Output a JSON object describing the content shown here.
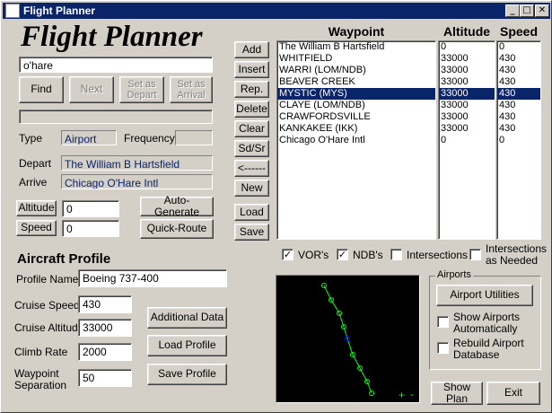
{
  "window": {
    "title": "Flight Planner"
  },
  "logo_text": "Flight Planner",
  "search": {
    "value": "o'hare"
  },
  "buttons": {
    "find": "Find",
    "next": "Next",
    "set_depart": "Set as Depart",
    "set_arrival": "Set as Arrival",
    "altitude": "Altitude",
    "speed": "Speed",
    "auto_generate": "Auto-Generate",
    "quick_route": "Quick-Route",
    "additional_data": "Additional Data",
    "load_profile": "Load Profile",
    "save_profile": "Save Profile",
    "airport_utilities": "Airport Utilities",
    "show_plan": "Show Plan",
    "exit": "Exit"
  },
  "info": {
    "type_label": "Type",
    "type_value": "Airport",
    "frequency_label": "Frequency",
    "frequency_value": "",
    "depart_label": "Depart",
    "depart_value": "The William B Hartsfield",
    "arrive_label": "Arrive",
    "arrive_value": "Chicago O'Hare Intl"
  },
  "route_inputs": {
    "altitude": "0",
    "speed": "0"
  },
  "aircraft_profile": {
    "title": "Aircraft Profile",
    "profile_name_label": "Profile Name",
    "profile_name": "Boeing 737-400",
    "cruise_speed_label": "Cruise Speed",
    "cruise_speed": "430",
    "cruise_altitude_label": "Cruise Altitude",
    "cruise_altitude": "33000",
    "climb_rate_label": "Climb Rate",
    "climb_rate": "2000",
    "waypoint_separation_label": "Waypoint Separation",
    "waypoint_separation": "50"
  },
  "list_buttons": [
    "Add",
    "Insert",
    "Rep.",
    "Delete",
    "Clear",
    "Sd/Sr",
    "<------",
    "New",
    "Load",
    "Save"
  ],
  "columns": {
    "waypoint": "Waypoint",
    "altitude": "Altitude",
    "speed": "Speed"
  },
  "waypoints": [
    {
      "name": "The William B Hartsfield",
      "altitude": "0",
      "speed": "0"
    },
    {
      "name": "WHITFIELD",
      "altitude": "33000",
      "speed": "430"
    },
    {
      "name": "WARRI (LOM/NDB)",
      "altitude": "33000",
      "speed": "430"
    },
    {
      "name": "BEAVER CREEK",
      "altitude": "33000",
      "speed": "430"
    },
    {
      "name": "MYSTIC (MYS)",
      "altitude": "33000",
      "speed": "430",
      "selected": true
    },
    {
      "name": "CLAYE (LOM/NDB)",
      "altitude": "33000",
      "speed": "430"
    },
    {
      "name": "CRAWFORDSVILLE",
      "altitude": "33000",
      "speed": "430"
    },
    {
      "name": "KANKAKEE (IKK)",
      "altitude": "33000",
      "speed": "430"
    },
    {
      "name": "Chicago O'Hare Intl",
      "altitude": "0",
      "speed": "0"
    }
  ],
  "filters": {
    "vors": {
      "label": "VOR's",
      "checked": true
    },
    "ndbs": {
      "label": "NDB's",
      "checked": true
    },
    "intersections": {
      "label": "Intersections",
      "checked": false
    },
    "intersections_needed": {
      "label": "Intersections as Needed",
      "checked": false
    }
  },
  "airports_group": {
    "label": "Airports",
    "show_airports": {
      "label": "Show Airports Automatically",
      "checked": false
    },
    "rebuild_db": {
      "label": "Rebuild Airport Database",
      "checked": false
    }
  },
  "map": {
    "zoom_in": "+",
    "zoom_out": "-",
    "route_color": "#00ff00",
    "selected_color": "#0000ff"
  },
  "colors": {
    "titlebar": "#0a246a",
    "selection": "#0a246a",
    "face": "#d4d0c8"
  }
}
